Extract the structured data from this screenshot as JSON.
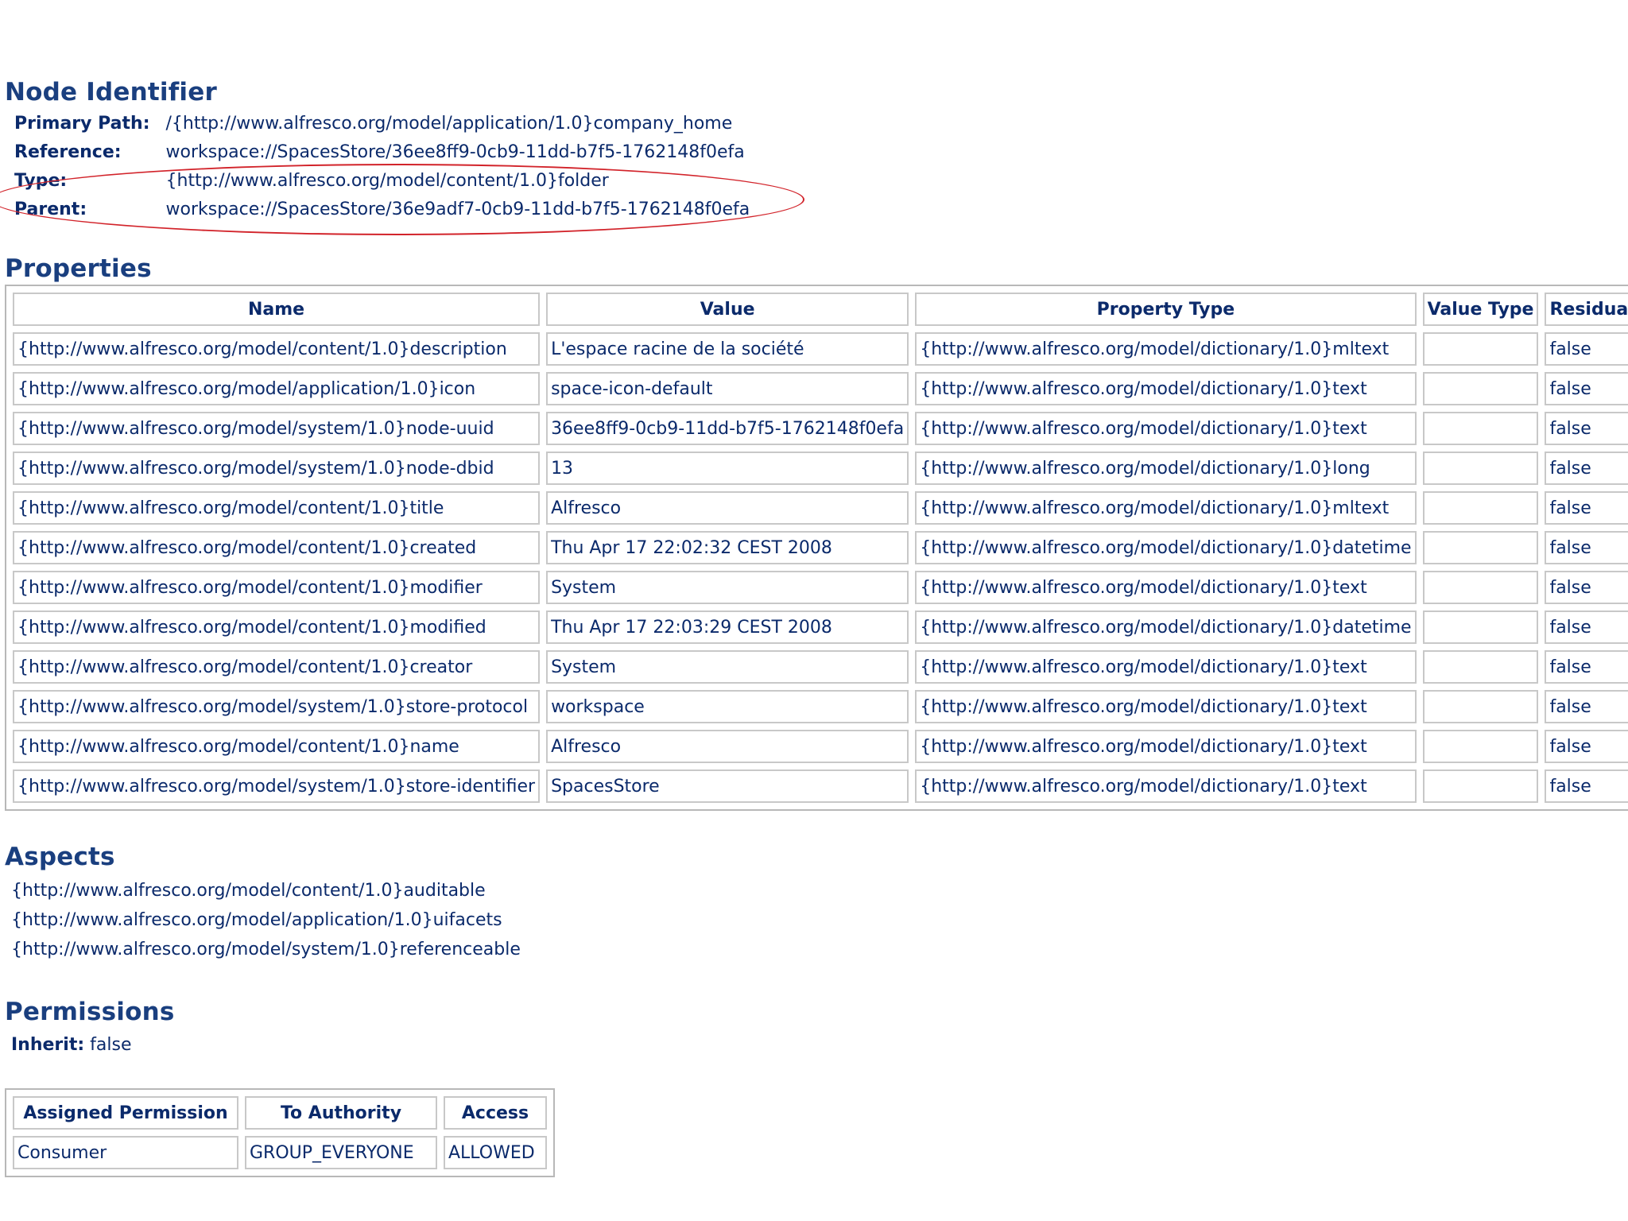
{
  "node_identifier": {
    "title": "Node Identifier",
    "rows": [
      {
        "label": "Primary Path:",
        "value": "/{http://www.alfresco.org/model/application/1.0}company_home"
      },
      {
        "label": "Reference:",
        "value": "workspace://SpacesStore/36ee8ff9-0cb9-11dd-b7f5-1762148f0efa"
      },
      {
        "label": "Type:",
        "value": "{http://www.alfresco.org/model/content/1.0}folder"
      },
      {
        "label": "Parent:",
        "value": "workspace://SpacesStore/36e9adf7-0cb9-11dd-b7f5-1762148f0efa"
      }
    ]
  },
  "properties": {
    "title": "Properties",
    "headers": [
      "Name",
      "Value",
      "Property Type",
      "Value Type",
      "Residual"
    ],
    "rows": [
      [
        "{http://www.alfresco.org/model/content/1.0}description",
        "L'espace racine de la société",
        "{http://www.alfresco.org/model/dictionary/1.0}mltext",
        "",
        "false"
      ],
      [
        "{http://www.alfresco.org/model/application/1.0}icon",
        "space-icon-default",
        "{http://www.alfresco.org/model/dictionary/1.0}text",
        "",
        "false"
      ],
      [
        "{http://www.alfresco.org/model/system/1.0}node-uuid",
        "36ee8ff9-0cb9-11dd-b7f5-1762148f0efa",
        "{http://www.alfresco.org/model/dictionary/1.0}text",
        "",
        "false"
      ],
      [
        "{http://www.alfresco.org/model/system/1.0}node-dbid",
        "13",
        "{http://www.alfresco.org/model/dictionary/1.0}long",
        "",
        "false"
      ],
      [
        "{http://www.alfresco.org/model/content/1.0}title",
        "Alfresco",
        "{http://www.alfresco.org/model/dictionary/1.0}mltext",
        "",
        "false"
      ],
      [
        "{http://www.alfresco.org/model/content/1.0}created",
        "Thu Apr 17 22:02:32 CEST 2008",
        "{http://www.alfresco.org/model/dictionary/1.0}datetime",
        "",
        "false"
      ],
      [
        "{http://www.alfresco.org/model/content/1.0}modifier",
        "System",
        "{http://www.alfresco.org/model/dictionary/1.0}text",
        "",
        "false"
      ],
      [
        "{http://www.alfresco.org/model/content/1.0}modified",
        "Thu Apr 17 22:03:29 CEST 2008",
        "{http://www.alfresco.org/model/dictionary/1.0}datetime",
        "",
        "false"
      ],
      [
        "{http://www.alfresco.org/model/content/1.0}creator",
        "System",
        "{http://www.alfresco.org/model/dictionary/1.0}text",
        "",
        "false"
      ],
      [
        "{http://www.alfresco.org/model/system/1.0}store-protocol",
        "workspace",
        "{http://www.alfresco.org/model/dictionary/1.0}text",
        "",
        "false"
      ],
      [
        "{http://www.alfresco.org/model/content/1.0}name",
        "Alfresco",
        "{http://www.alfresco.org/model/dictionary/1.0}text",
        "",
        "false"
      ],
      [
        "{http://www.alfresco.org/model/system/1.0}store-identifier",
        "SpacesStore",
        "{http://www.alfresco.org/model/dictionary/1.0}text",
        "",
        "false"
      ]
    ]
  },
  "aspects": {
    "title": "Aspects",
    "items": [
      "{http://www.alfresco.org/model/content/1.0}auditable",
      "{http://www.alfresco.org/model/application/1.0}uifacets",
      "{http://www.alfresco.org/model/system/1.0}referenceable"
    ]
  },
  "permissions": {
    "title": "Permissions",
    "inherit_label": "Inherit:",
    "inherit_value": "false",
    "headers": [
      "Assigned Permission",
      "To Authority",
      "Access"
    ],
    "rows": [
      [
        "Consumer",
        "GROUP_EVERYONE",
        "ALLOWED"
      ]
    ]
  },
  "annotation_color": "#d2232a",
  "text_color": "#0b2a6b"
}
